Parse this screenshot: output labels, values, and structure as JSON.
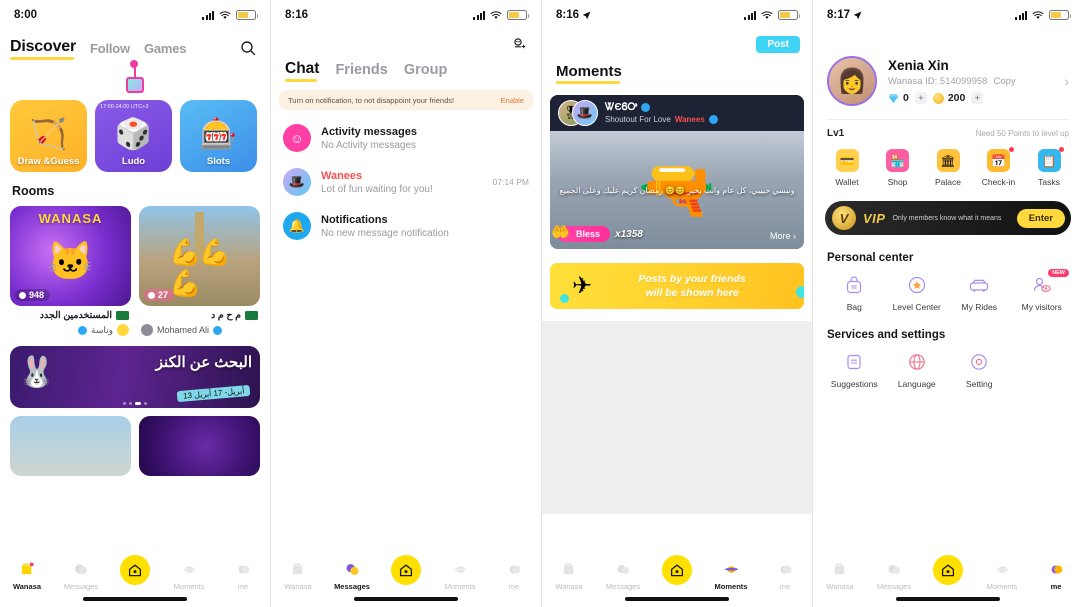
{
  "panels": {
    "discover": {
      "status": {
        "time": "8:00",
        "has_location_arrow": false,
        "battery_icon": "battery-icon",
        "wifi_icon": "wifi-icon",
        "signal_icon": "signal-icon"
      },
      "tabs": [
        {
          "label": "Discover",
          "active": true
        },
        {
          "label": "Follow",
          "active": false
        },
        {
          "label": "Games",
          "active": false
        }
      ],
      "search_icon": "search-icon",
      "pin_icon": "location-pin-icon",
      "games": [
        {
          "label": "Draw &Guess",
          "time": "",
          "art": "🏹"
        },
        {
          "label": "Ludo",
          "time": "17:00-24:00 UTC+3",
          "art": "🎲"
        },
        {
          "label": "Slots",
          "time": "",
          "art": "🎰"
        }
      ],
      "rooms_header": "Rooms",
      "rooms": [
        {
          "brand": "WANASA",
          "viewers": "948",
          "title": "المستخدمين الجدد",
          "user": "وناسة",
          "art": "🐱"
        },
        {
          "brand": "",
          "viewers": "27",
          "title": "م ح م د",
          "user": "Mohamed Ali",
          "art": "💪"
        }
      ],
      "promo": {
        "title_ar": "البحث عن الكنز",
        "dates": "13 أبريل- 17 أبريل",
        "mascot": "🐰"
      }
    },
    "chat": {
      "status": {
        "time": "8:16"
      },
      "top_icon": "add-friend-icon",
      "tabs": [
        {
          "label": "Chat",
          "active": true
        },
        {
          "label": "Friends",
          "active": false
        },
        {
          "label": "Group",
          "active": false
        }
      ],
      "notice": {
        "text": "Turn on notification, to not disappoint your friends!",
        "action": "Enable"
      },
      "items": [
        {
          "title": "Activity messages",
          "subtitle": "No Activity messages",
          "time": "",
          "avatar": "activity-avatar",
          "title_red": false,
          "glyph": "☺"
        },
        {
          "title": "Wanees",
          "subtitle": "Lot of fun waiting for you!",
          "time": "07:14 PM",
          "avatar": "wanees-avatar",
          "title_red": true,
          "glyph": "🎩"
        },
        {
          "title": "Notifications",
          "subtitle": "No new message notification",
          "time": "",
          "avatar": "notifications-avatar",
          "title_red": false,
          "glyph": "🔔"
        }
      ]
    },
    "moments": {
      "status": {
        "time": "8:16",
        "has_location_arrow": true
      },
      "post_button": "Post",
      "title": "Moments",
      "card": {
        "name": "ᏔЄᏮᎤ",
        "subtitle_prefix": "Shoutout For Love",
        "subtitle_highlight": "Wanees",
        "caption": "ونبسي حبيبي، كل عام وانت بخير 😊😊 رمضان كريم عليك وعلى الجميع",
        "bless_label": "Bless",
        "multiplier": "x1358",
        "more_label": "More ›"
      },
      "empty_banner": {
        "line1": "Posts by your friends",
        "line2": "will be shown here",
        "icon": "paper-plane-icon"
      }
    },
    "me": {
      "status": {
        "time": "8:17",
        "has_location_arrow": true
      },
      "profile": {
        "name": "Xenia Xin",
        "id_label": "Wanasa ID: 514099958",
        "copy_label": "Copy",
        "diamonds": "0",
        "coins": "200",
        "chevron": "›"
      },
      "level": {
        "label": "Lv1",
        "hint": "Need 50 Points to level up"
      },
      "quick_icons": [
        {
          "label": "Wallet",
          "glyph": "💳",
          "color": "#FFCF4D",
          "dot": false
        },
        {
          "label": "Shop",
          "glyph": "🏪",
          "color": "#FF5FA2",
          "dot": false
        },
        {
          "label": "Palace",
          "glyph": "🏛",
          "color": "#FFC23C",
          "dot": false
        },
        {
          "label": "Check-in",
          "glyph": "📅",
          "color": "#FFB92E",
          "dot": true
        },
        {
          "label": "Tasks",
          "glyph": "📋",
          "color": "#35B8F0",
          "dot": true
        }
      ],
      "vip": {
        "word": "VIP",
        "subtitle": "Only members know what it means",
        "button": "Enter",
        "badge": "V"
      },
      "personal_center": {
        "title": "Personal center",
        "items": [
          {
            "label": "Bag",
            "glyph": "🎒",
            "tag": ""
          },
          {
            "label": "Level Center",
            "glyph": "⭐",
            "tag": ""
          },
          {
            "label": "My Rides",
            "glyph": "🚗",
            "tag": ""
          },
          {
            "label": "My visitors",
            "glyph": "👁",
            "tag": "NEW"
          }
        ]
      },
      "services": {
        "title": "Services and settings",
        "items": [
          {
            "label": "Suggestions",
            "glyph": "📝"
          },
          {
            "label": "Language",
            "glyph": "🌐"
          },
          {
            "label": "Setting",
            "glyph": "⚙"
          }
        ]
      }
    }
  },
  "nav": {
    "items": [
      {
        "label": "Wanasa",
        "icon": "wanasa-bag-icon"
      },
      {
        "label": "Messages",
        "icon": "messages-icon"
      },
      {
        "label": "",
        "icon": "home-icon"
      },
      {
        "label": "Moments",
        "icon": "moments-icon"
      },
      {
        "label": "me",
        "icon": "me-icon"
      }
    ],
    "active_per_panel": [
      0,
      1,
      3,
      4
    ]
  },
  "colors": {
    "accent_yellow": "#FFD83D",
    "home_yellow": "#FFE000",
    "post_blue": "#3FD3F5",
    "red": "#F2524F",
    "verified_blue": "#2EA7F2",
    "pink": "#FF3FA4"
  }
}
